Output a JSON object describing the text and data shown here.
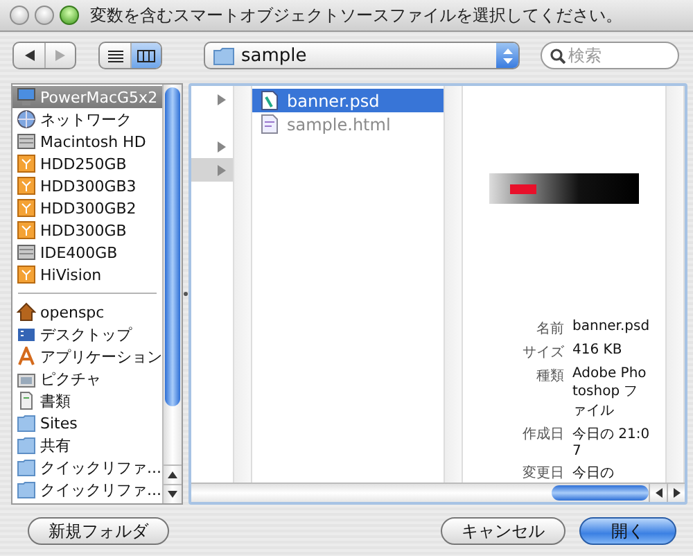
{
  "window": {
    "title": "変数を含むスマートオブジェクトソースファイルを選択してください。"
  },
  "toolbar": {
    "nav": [
      {
        "kind": "back",
        "disabled": false
      },
      {
        "kind": "forward",
        "disabled": true
      }
    ],
    "views": [
      {
        "kind": "list",
        "selected": false
      },
      {
        "kind": "columns",
        "selected": true
      }
    ],
    "path": "sample",
    "search": {
      "placeholder": "検索"
    }
  },
  "sidebar": {
    "devices": [
      {
        "name": "PowerMacG5x2",
        "kind": "computer",
        "selected": true
      },
      {
        "name": "ネットワーク",
        "kind": "network",
        "selected": false
      },
      {
        "name": "Macintosh HD",
        "kind": "disk",
        "selected": false
      },
      {
        "name": "HDD250GB",
        "kind": "drive",
        "selected": false
      },
      {
        "name": "HDD300GB3",
        "kind": "drive",
        "selected": false
      },
      {
        "name": "HDD300GB2",
        "kind": "drive",
        "selected": false
      },
      {
        "name": "HDD300GB",
        "kind": "drive",
        "selected": false
      },
      {
        "name": "IDE400GB",
        "kind": "disk",
        "selected": false
      },
      {
        "name": "HiVision",
        "kind": "drive",
        "selected": false
      }
    ],
    "places": [
      {
        "name": "openspc",
        "kind": "home",
        "selected": false
      },
      {
        "name": "デスクトップ",
        "kind": "desktop",
        "selected": false
      },
      {
        "name": "アプリケーション",
        "kind": "apps",
        "selected": false
      },
      {
        "name": "ピクチャ",
        "kind": "pictures",
        "selected": false
      },
      {
        "name": "書類",
        "kind": "documents",
        "selected": false
      },
      {
        "name": "Sites",
        "kind": "folder",
        "selected": false
      },
      {
        "name": "共有",
        "kind": "folder",
        "selected": false
      },
      {
        "name": "クイックリファ...",
        "kind": "folder",
        "selected": false
      },
      {
        "name": "クイックリファ...",
        "kind": "folder",
        "selected": false
      }
    ]
  },
  "browser": {
    "column_1": [
      {
        "selected": false
      },
      {
        "selected": false
      },
      {
        "selected": true
      }
    ],
    "files": [
      {
        "name": "banner.psd",
        "kind": "psd",
        "selected": true,
        "disabled": false
      },
      {
        "name": "sample.html",
        "kind": "html",
        "selected": false,
        "disabled": true
      }
    ],
    "preview": {
      "kind": "picture",
      "info": [
        {
          "label": "名前",
          "value": "banner.psd"
        },
        {
          "label": "サイズ",
          "value": "416 KB"
        },
        {
          "label": "種類",
          "value": "Adobe Photoshop ファイル"
        },
        {
          "label": "作成日",
          "value": "今日の 21:07"
        },
        {
          "label": "変更日",
          "value": "今日の"
        }
      ]
    }
  },
  "buttons": [
    {
      "label": "新規フォルダ",
      "default": false
    },
    {
      "label": "キャンセル",
      "default": false
    },
    {
      "label": "開く",
      "default": true
    }
  ]
}
